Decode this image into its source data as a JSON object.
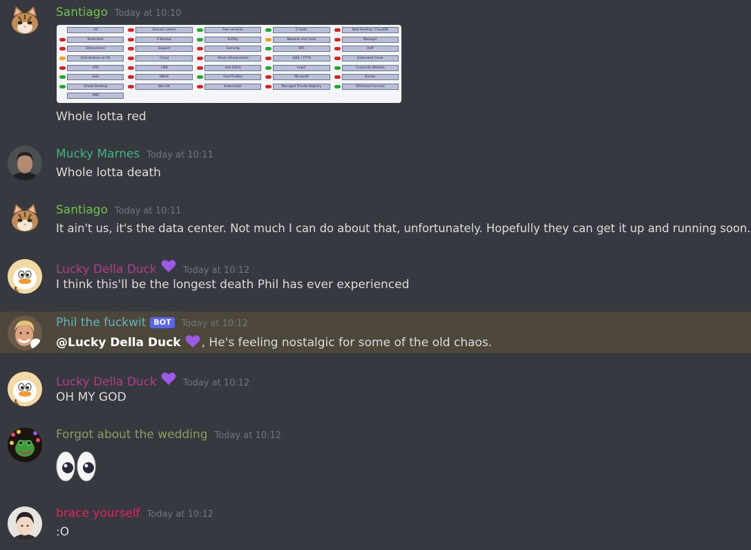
{
  "messages": [
    {
      "user": "Santiago",
      "time": "Today at 10:10",
      "text": "Whole lotta red"
    },
    {
      "user": "Mucky Marnes",
      "time": "Today at 10:11",
      "text": "Whole lotta death"
    },
    {
      "user": "Santiago",
      "time": "Today at 10:11",
      "text": "It ain't us, it's the data center. Not much I can do about that, unfortunately. Hopefully they can get it up and running soon."
    },
    {
      "user": "Lucky Della Duck",
      "time": "Today at 10:12",
      "text": "I think this'll be the longest death Phil has ever experienced"
    },
    {
      "user": "Phil the fuckwit",
      "badge": "BOT",
      "time": "Today at 10:12",
      "mention": "@Lucky Della Duck",
      "text": ", He's feeling nostalgic for some of the old chaos."
    },
    {
      "user": "Lucky Della Duck",
      "time": "Today at 10:12",
      "text": "OH MY GOD"
    },
    {
      "user": "Forgot about the wedding",
      "time": "Today at 10:12",
      "text": ""
    },
    {
      "user": "brace yourself",
      "time": "Today at 10:12",
      "text": ":O"
    }
  ],
  "colors": {
    "santiago": "#71c44a",
    "mucky": "#43b581",
    "lucky": "#b33d8a",
    "phil": "#5fb7c1",
    "forgot": "#8d9d5a",
    "brace": "#e91e63",
    "heart": "#9b59e6"
  },
  "status_grid": [
    {
      "s": "none",
      "label": "All"
    },
    {
      "s": "red",
      "label": "Domain names"
    },
    {
      "s": "green",
      "label": "Free services"
    },
    {
      "s": "green",
      "label": "E-mails"
    },
    {
      "s": "red",
      "label": "Web Hosting / CloudDB"
    },
    {
      "s": "red",
      "label": "Dedicated"
    },
    {
      "s": "red",
      "label": "E-Backup"
    },
    {
      "s": "green",
      "label": "Te2Pay"
    },
    {
      "s": "orange",
      "label": "Network and racks"
    },
    {
      "s": "red",
      "label": "Manager"
    },
    {
      "s": "red",
      "label": "Datacenters"
    },
    {
      "s": "red",
      "label": "Support"
    },
    {
      "s": "red",
      "label": "Gamerig"
    },
    {
      "s": "green",
      "label": "RPS"
    },
    {
      "s": "red",
      "label": "VoIP"
    },
    {
      "s": "orange",
      "label": "Distributions et OS"
    },
    {
      "s": "red",
      "label": "Cloud"
    },
    {
      "s": "red",
      "label": "vRack infrastructure"
    },
    {
      "s": "red",
      "label": "xDSL / FTTH"
    },
    {
      "s": "red",
      "label": "Dedicated Cloud"
    },
    {
      "s": "red",
      "label": "VPS"
    },
    {
      "s": "red",
      "label": "CDN"
    },
    {
      "s": "red",
      "label": "Anti-DDoS"
    },
    {
      "s": "green",
      "label": "hubiC"
    },
    {
      "s": "green",
      "label": "Corporate Website"
    },
    {
      "s": "green",
      "label": "IaaS"
    },
    {
      "s": "red",
      "label": "SMedi"
    },
    {
      "s": "green",
      "label": "OverTheBox"
    },
    {
      "s": "red",
      "label": "Microsoft"
    },
    {
      "s": "red",
      "label": "Docker"
    },
    {
      "s": "green",
      "label": "Virtual Desktop"
    },
    {
      "s": "red",
      "label": "Nas-HA"
    },
    {
      "s": "red",
      "label": "Kubernetes"
    },
    {
      "s": "red",
      "label": "Managed Private Registry"
    },
    {
      "s": "green",
      "label": "OVHcloud Connect"
    },
    {
      "s": "none",
      "label": "VMS"
    }
  ],
  "icons": {
    "santiago_avatar": "cat-avatar-icon",
    "mucky_avatar": "man-avatar-icon",
    "lucky_avatar": "duck-avatar-icon",
    "phil_avatar": "blond-man-avatar-icon",
    "forgot_avatar": "frog-avatar-icon",
    "brace_avatar": "person-avatar-icon",
    "heart": "purple-heart-icon",
    "eyes": "eyes-emoji-icon"
  }
}
